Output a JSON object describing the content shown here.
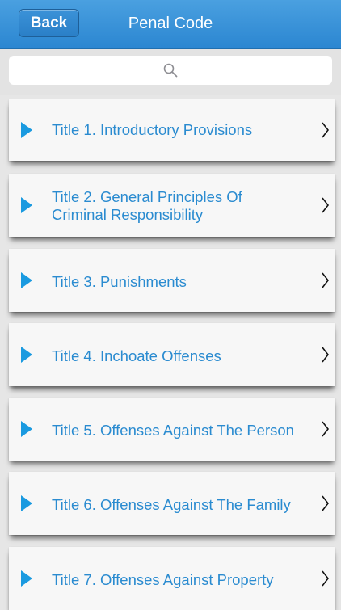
{
  "navbar": {
    "back_label": "Back",
    "title": "Penal Code"
  },
  "search": {
    "placeholder": ""
  },
  "list": {
    "items": [
      {
        "line1": "Title 1. Introductory Provisions",
        "line2": ""
      },
      {
        "line1": "Title 2. General Principles Of",
        "line2": "Criminal Responsibility"
      },
      {
        "line1": "Title 3. Punishments",
        "line2": ""
      },
      {
        "line1": "Title 4. Inchoate Offenses",
        "line2": ""
      },
      {
        "line1": "Title 5. Offenses Against The Person",
        "line2": ""
      },
      {
        "line1": "Title 6. Offenses Against The Family",
        "line2": ""
      },
      {
        "line1": "Title 7. Offenses Against Property",
        "line2": ""
      }
    ]
  },
  "colors": {
    "navbar": "#2b86d1",
    "accent": "#1a9ae0",
    "label_text": "#2a8bd0",
    "row_bg": "#f7f7f7",
    "page_bg": "#e6e6e6"
  },
  "icons": {
    "search": "search-icon",
    "row_marker": "play-triangle-icon",
    "row_disclosure": "chevron-right-icon"
  }
}
